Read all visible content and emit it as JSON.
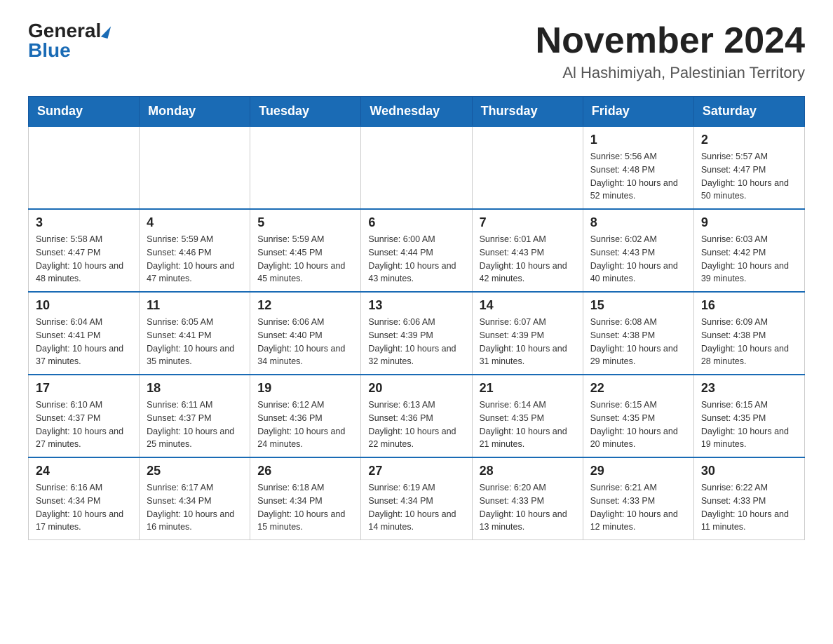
{
  "logo": {
    "general": "General",
    "blue": "Blue"
  },
  "title": "November 2024",
  "subtitle": "Al Hashimiyah, Palestinian Territory",
  "days_of_week": [
    "Sunday",
    "Monday",
    "Tuesday",
    "Wednesday",
    "Thursday",
    "Friday",
    "Saturday"
  ],
  "weeks": [
    [
      {
        "day": "",
        "info": ""
      },
      {
        "day": "",
        "info": ""
      },
      {
        "day": "",
        "info": ""
      },
      {
        "day": "",
        "info": ""
      },
      {
        "day": "",
        "info": ""
      },
      {
        "day": "1",
        "info": "Sunrise: 5:56 AM\nSunset: 4:48 PM\nDaylight: 10 hours and 52 minutes."
      },
      {
        "day": "2",
        "info": "Sunrise: 5:57 AM\nSunset: 4:47 PM\nDaylight: 10 hours and 50 minutes."
      }
    ],
    [
      {
        "day": "3",
        "info": "Sunrise: 5:58 AM\nSunset: 4:47 PM\nDaylight: 10 hours and 48 minutes."
      },
      {
        "day": "4",
        "info": "Sunrise: 5:59 AM\nSunset: 4:46 PM\nDaylight: 10 hours and 47 minutes."
      },
      {
        "day": "5",
        "info": "Sunrise: 5:59 AM\nSunset: 4:45 PM\nDaylight: 10 hours and 45 minutes."
      },
      {
        "day": "6",
        "info": "Sunrise: 6:00 AM\nSunset: 4:44 PM\nDaylight: 10 hours and 43 minutes."
      },
      {
        "day": "7",
        "info": "Sunrise: 6:01 AM\nSunset: 4:43 PM\nDaylight: 10 hours and 42 minutes."
      },
      {
        "day": "8",
        "info": "Sunrise: 6:02 AM\nSunset: 4:43 PM\nDaylight: 10 hours and 40 minutes."
      },
      {
        "day": "9",
        "info": "Sunrise: 6:03 AM\nSunset: 4:42 PM\nDaylight: 10 hours and 39 minutes."
      }
    ],
    [
      {
        "day": "10",
        "info": "Sunrise: 6:04 AM\nSunset: 4:41 PM\nDaylight: 10 hours and 37 minutes."
      },
      {
        "day": "11",
        "info": "Sunrise: 6:05 AM\nSunset: 4:41 PM\nDaylight: 10 hours and 35 minutes."
      },
      {
        "day": "12",
        "info": "Sunrise: 6:06 AM\nSunset: 4:40 PM\nDaylight: 10 hours and 34 minutes."
      },
      {
        "day": "13",
        "info": "Sunrise: 6:06 AM\nSunset: 4:39 PM\nDaylight: 10 hours and 32 minutes."
      },
      {
        "day": "14",
        "info": "Sunrise: 6:07 AM\nSunset: 4:39 PM\nDaylight: 10 hours and 31 minutes."
      },
      {
        "day": "15",
        "info": "Sunrise: 6:08 AM\nSunset: 4:38 PM\nDaylight: 10 hours and 29 minutes."
      },
      {
        "day": "16",
        "info": "Sunrise: 6:09 AM\nSunset: 4:38 PM\nDaylight: 10 hours and 28 minutes."
      }
    ],
    [
      {
        "day": "17",
        "info": "Sunrise: 6:10 AM\nSunset: 4:37 PM\nDaylight: 10 hours and 27 minutes."
      },
      {
        "day": "18",
        "info": "Sunrise: 6:11 AM\nSunset: 4:37 PM\nDaylight: 10 hours and 25 minutes."
      },
      {
        "day": "19",
        "info": "Sunrise: 6:12 AM\nSunset: 4:36 PM\nDaylight: 10 hours and 24 minutes."
      },
      {
        "day": "20",
        "info": "Sunrise: 6:13 AM\nSunset: 4:36 PM\nDaylight: 10 hours and 22 minutes."
      },
      {
        "day": "21",
        "info": "Sunrise: 6:14 AM\nSunset: 4:35 PM\nDaylight: 10 hours and 21 minutes."
      },
      {
        "day": "22",
        "info": "Sunrise: 6:15 AM\nSunset: 4:35 PM\nDaylight: 10 hours and 20 minutes."
      },
      {
        "day": "23",
        "info": "Sunrise: 6:15 AM\nSunset: 4:35 PM\nDaylight: 10 hours and 19 minutes."
      }
    ],
    [
      {
        "day": "24",
        "info": "Sunrise: 6:16 AM\nSunset: 4:34 PM\nDaylight: 10 hours and 17 minutes."
      },
      {
        "day": "25",
        "info": "Sunrise: 6:17 AM\nSunset: 4:34 PM\nDaylight: 10 hours and 16 minutes."
      },
      {
        "day": "26",
        "info": "Sunrise: 6:18 AM\nSunset: 4:34 PM\nDaylight: 10 hours and 15 minutes."
      },
      {
        "day": "27",
        "info": "Sunrise: 6:19 AM\nSunset: 4:34 PM\nDaylight: 10 hours and 14 minutes."
      },
      {
        "day": "28",
        "info": "Sunrise: 6:20 AM\nSunset: 4:33 PM\nDaylight: 10 hours and 13 minutes."
      },
      {
        "day": "29",
        "info": "Sunrise: 6:21 AM\nSunset: 4:33 PM\nDaylight: 10 hours and 12 minutes."
      },
      {
        "day": "30",
        "info": "Sunrise: 6:22 AM\nSunset: 4:33 PM\nDaylight: 10 hours and 11 minutes."
      }
    ]
  ]
}
